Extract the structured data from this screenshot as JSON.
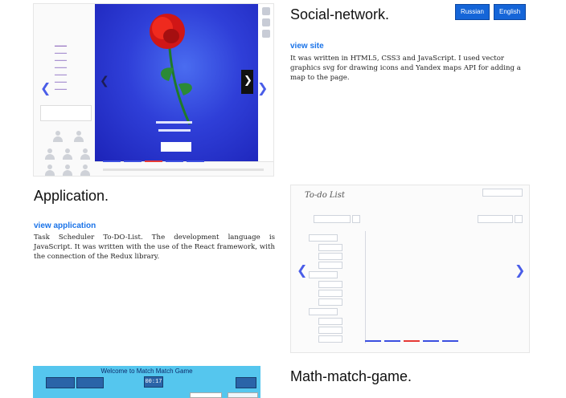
{
  "languages": {
    "russian": "Russian",
    "english": "English"
  },
  "projects": [
    {
      "title": "Social-network.",
      "link_label": "view site",
      "description": "It was written in HTML5, CSS3 and JavaScript. I used vector graphics svg for drawing icons and Yandex maps API for adding a map to the page."
    },
    {
      "title": "Application.",
      "link_label": "view application",
      "description": "Task Scheduler To-DO-List. The development language is JavaScript. It was written with the use of the React framework, with the connection of the Redux library."
    },
    {
      "title": "Math-match-game."
    }
  ],
  "screens": {
    "todo_title": "To-do List",
    "game_title": "Welcome to Match Match Game",
    "game_timer": "00:17"
  },
  "colors": {
    "link": "#1a73e8",
    "button": "#1565d8",
    "hero": "#2f3fd8",
    "game": "#55c6ee"
  }
}
